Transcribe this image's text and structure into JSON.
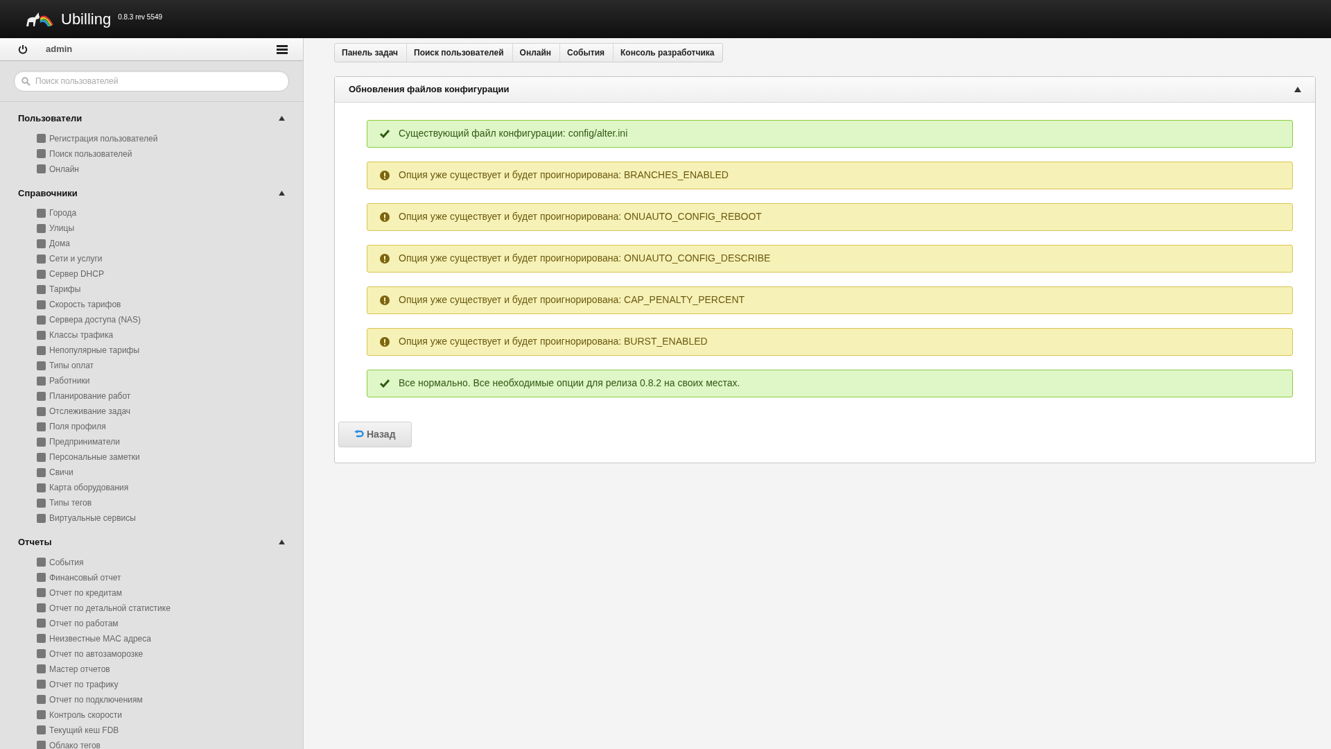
{
  "header": {
    "brand": "Ubilling",
    "version": "0.8.3 rev 5549"
  },
  "user": {
    "name": "admin"
  },
  "search": {
    "placeholder": "Поиск пользователей"
  },
  "sidebar": {
    "sections": [
      {
        "title": "Пользователи",
        "expanded": true,
        "items": [
          "Регистрация пользователей",
          "Поиск пользователей",
          "Онлайн"
        ]
      },
      {
        "title": "Справочники",
        "expanded": true,
        "items": [
          "Города",
          "Улицы",
          "Дома",
          "Сети и услуги",
          "Сервер DHCP",
          "Тарифы",
          "Скорость тарифов",
          "Сервера доступа (NAS)",
          "Классы трафика",
          "Непопулярные тарифы",
          "Типы оплат",
          "Работники",
          "Планирование работ",
          "Отслеживание задач",
          "Поля профиля",
          "Предприниматели",
          "Персональные заметки",
          "Свичи",
          "Карта оборудования",
          "Типы тегов",
          "Виртуальные сервисы"
        ]
      },
      {
        "title": "Отчеты",
        "expanded": true,
        "items": [
          "События",
          "Финансовый отчет",
          "Отчет по кредитам",
          "Отчет по детальной статистике",
          "Отчет по работам",
          "Неизвестные MAC адреса",
          "Отчет по автозаморозке",
          "Мастер отчетов",
          "Отчет по трафику",
          "Отчет по подключениям",
          "Контроль скорости",
          "Текущий кеш FDB",
          "Облако тегов"
        ]
      }
    ]
  },
  "breadcrumbs": [
    "Панель задач",
    "Поиск пользователей",
    "Онлайн",
    "События",
    "Консоль разработчика"
  ],
  "panel": {
    "title": "Обновления файлов конфигурации",
    "expanded": true,
    "messages": [
      {
        "kind": "success",
        "text": "Существующий файл конфигурации: config/alter.ini"
      },
      {
        "kind": "warning",
        "text": "Опция уже существует и будет проигнорирована: BRANCHES_ENABLED"
      },
      {
        "kind": "warning",
        "text": "Опция уже существует и будет проигнорирована: ONUAUTO_CONFIG_REBOOT"
      },
      {
        "kind": "warning",
        "text": "Опция уже существует и будет проигнорирована: ONUAUTO_CONFIG_DESCRIBE"
      },
      {
        "kind": "warning",
        "text": "Опция уже существует и будет проигнорирована: CAP_PENALTY_PERCENT"
      },
      {
        "kind": "warning",
        "text": "Опция уже существует и будет проигнорирована: BURST_ENABLED"
      },
      {
        "kind": "success",
        "text": "Все нормально. Все необходимые опции для релиза 0.8.2 на своих местах."
      }
    ],
    "back_button": "Назад"
  }
}
